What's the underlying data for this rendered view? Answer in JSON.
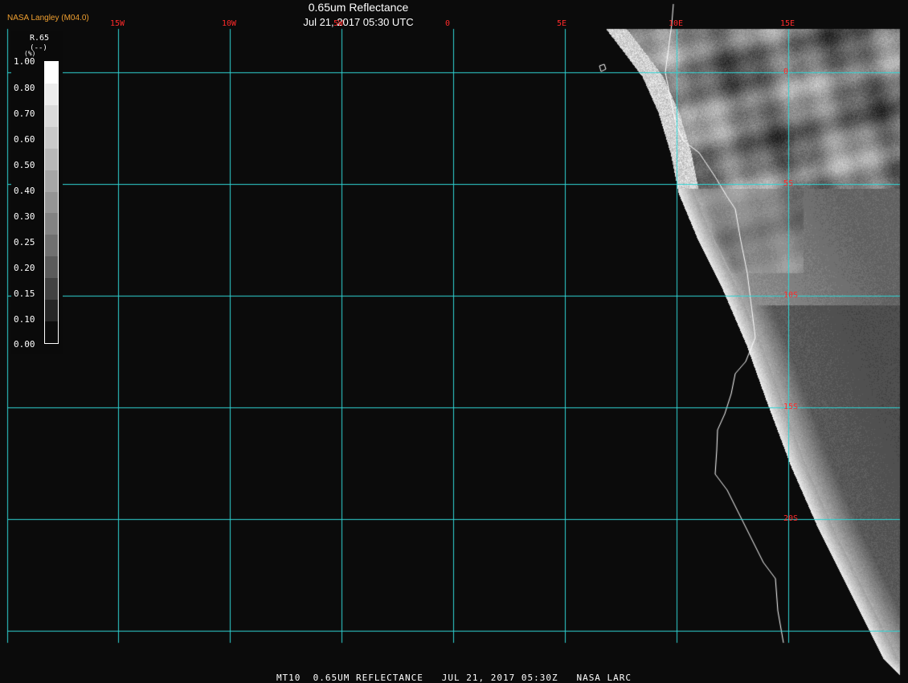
{
  "header": {
    "title": "0.65um Reflectance",
    "datetime": "Jul 21, 2017 05:30 UTC",
    "source": "NASA Langley (M04.0)"
  },
  "footer": {
    "caption": "MT10  0.65UM REFLECTANCE   JUL 21, 2017 05:30Z   NASA LARC"
  },
  "legend": {
    "title": "R.65",
    "unit": "(--)",
    "unit_small": "(%)",
    "labels": [
      "1.00",
      "0.80",
      "0.70",
      "0.60",
      "0.50",
      "0.40",
      "0.30",
      "0.25",
      "0.20",
      "0.15",
      "0.10",
      "0.00"
    ],
    "colors": [
      "#ffffff",
      "#ececec",
      "#dadada",
      "#c9c9c9",
      "#b8b8b8",
      "#a6a6a6",
      "#959595",
      "#838383",
      "#707070",
      "#5b5b5b",
      "#424242",
      "#262626",
      "#0c0c0c"
    ]
  },
  "graticule": {
    "longitudes": [
      "15W",
      "10W",
      "5W",
      "0",
      "5E",
      "10E",
      "15E"
    ],
    "latitudes": [
      "0",
      "5S",
      "10S",
      "15S",
      "20S"
    ],
    "line_color": "#2fd6d6",
    "label_color": "#ff2a2a"
  },
  "colors": {
    "background": "#0b0b0b",
    "ocean": "#0b0b0b",
    "coastline": "#ffffff"
  }
}
